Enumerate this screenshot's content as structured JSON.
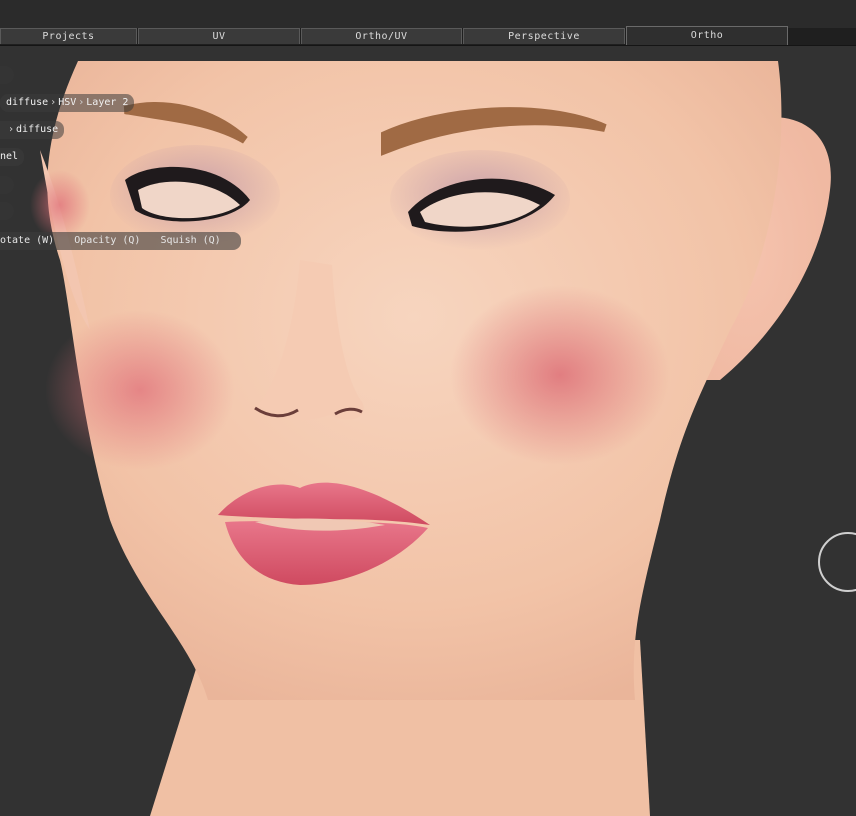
{
  "tabs": [
    {
      "label": "Projects",
      "active": false
    },
    {
      "label": "UV",
      "active": false
    },
    {
      "label": "Ortho/UV",
      "active": false
    },
    {
      "label": "Perspective",
      "active": false
    },
    {
      "label": "Ortho",
      "active": true
    }
  ],
  "breadcrumb": {
    "layer_path": [
      "diffuse",
      "HSV",
      "Layer 2"
    ],
    "channel_path": [
      "diffuse"
    ],
    "channel_label": "nel"
  },
  "tools": [
    "otate (W)",
    "Opacity (Q)",
    "Squish (Q)"
  ],
  "colors": {
    "background": "#323232",
    "tab_bar": "#1f1f1f",
    "skin": "#f4c8b0",
    "lips": "#d9566a",
    "brows": "#a06a44"
  },
  "icons": {
    "brush_cursor": "brush-ring-icon",
    "separator": "chevron-right-icon"
  }
}
